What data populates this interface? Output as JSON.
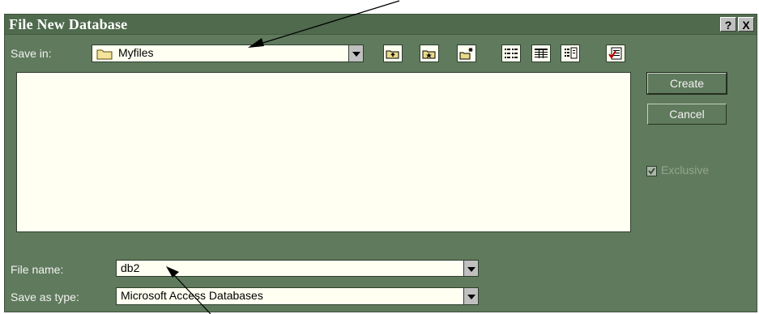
{
  "dialog": {
    "title": "File New Database",
    "help_button": "?",
    "close_button": "X"
  },
  "save_in": {
    "label": "Save in:",
    "value": "Myfiles"
  },
  "toolbar": {
    "icons": [
      "up-one-level-icon",
      "look-in-favorites-icon",
      "create-new-folder-icon",
      "list-view-icon",
      "details-view-icon",
      "properties-view-icon",
      "commands-settings-icon"
    ]
  },
  "buttons": {
    "create": "Create",
    "cancel": "Cancel"
  },
  "exclusive": {
    "label": "Exclusive",
    "checked": true,
    "enabled": false
  },
  "file_name": {
    "label": "File name:",
    "value": "db2"
  },
  "save_as_type": {
    "label": "Save as type:",
    "value": "Microsoft Access Databases"
  },
  "colors": {
    "dialog_bg": "#5f7a5c",
    "title_bar": "#4f6a4d",
    "field_bg": "#fffff2",
    "annotation_arrow": "#000000"
  }
}
